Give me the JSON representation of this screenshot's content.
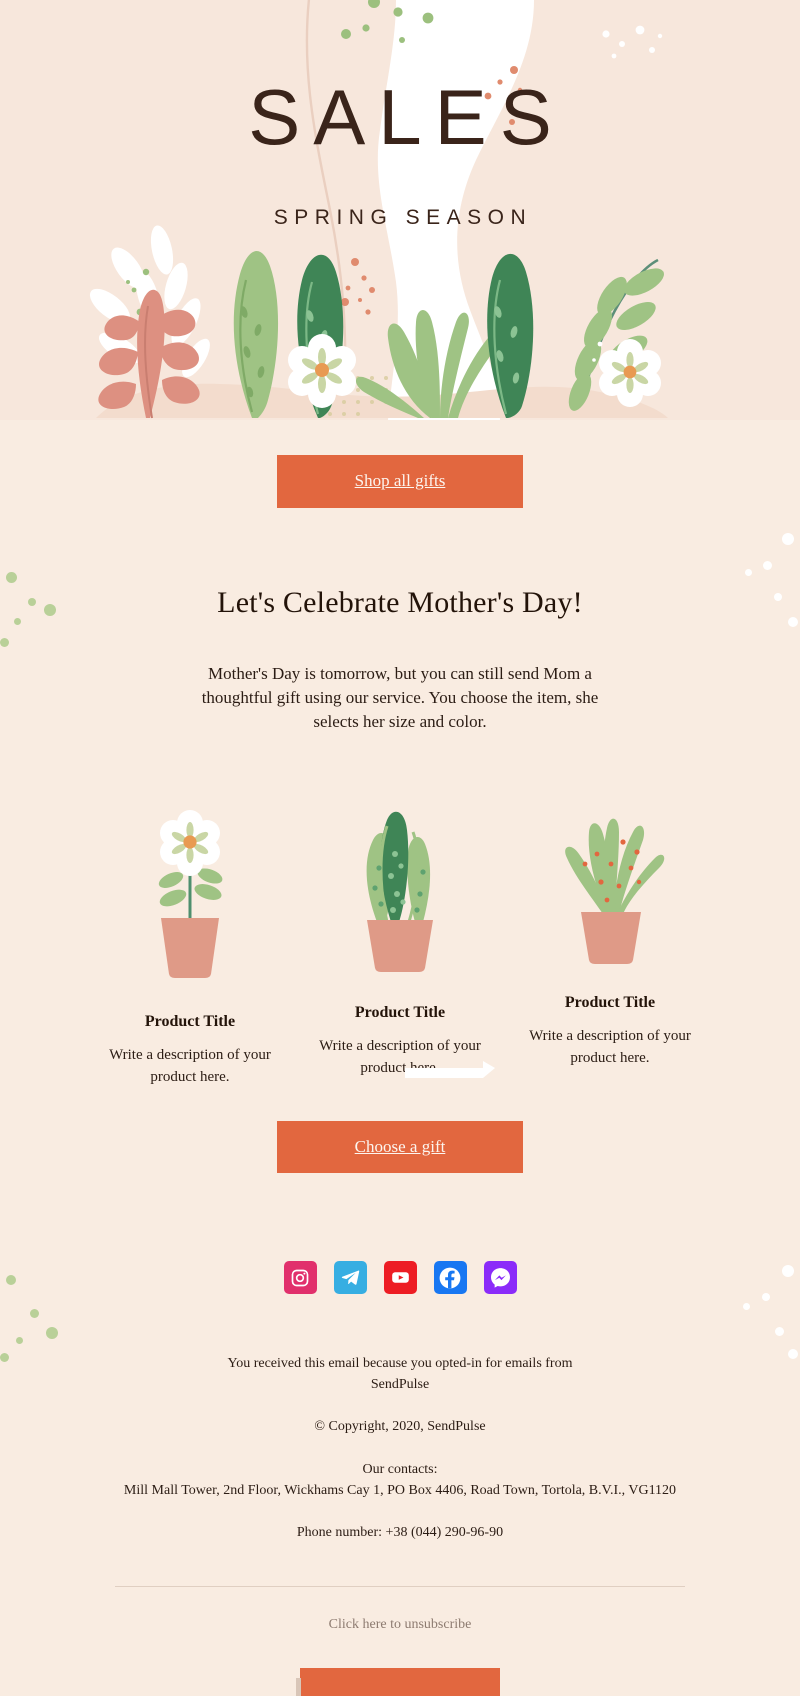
{
  "theme": {
    "page_bg": "#f9ece1",
    "hero_bg": "#f7e7dc",
    "accent": "#e2673f",
    "text": "#2b1c14",
    "heading": "#231309",
    "muted": "#8d7b70"
  },
  "hero": {
    "title": "SALES",
    "subtitle": "SPRING SEASON"
  },
  "cta_primary": {
    "label": "Shop all gifts"
  },
  "celebrate": {
    "heading": "Let's Celebrate Mother's Day!",
    "paragraph": "Mother's Day is tomorrow, but you can still send Mom a thoughtful gift using our service. You choose the item, she selects her size and color."
  },
  "products": [
    {
      "title": "Product Title",
      "description": "Write a description of your product here.",
      "art": "flower-plant-illustration"
    },
    {
      "title": "Product Title",
      "description": "Write a description of your product here.",
      "art": "snake-plant-illustration"
    },
    {
      "title": "Product Title",
      "description": "Write a description of your product here.",
      "art": "aloe-plant-illustration"
    }
  ],
  "cta_secondary": {
    "label": "Choose a gift"
  },
  "social": [
    {
      "name": "instagram",
      "label": "Instagram",
      "color": "#e1306c"
    },
    {
      "name": "telegram",
      "label": "Telegram",
      "color": "#37aee2"
    },
    {
      "name": "youtube",
      "label": "YouTube",
      "color": "#ed1d24"
    },
    {
      "name": "facebook",
      "label": "Facebook",
      "color": "#1877f2"
    },
    {
      "name": "messenger",
      "label": "Messenger",
      "color": "#8b2bf9"
    }
  ],
  "footer": {
    "optin_line1": "You received this email because you opted-in for emails from",
    "optin_line2": "SendPulse",
    "copyright": "© Copyright, 2020, SendPulse",
    "contacts_label": "Our contacts:",
    "address": "Mill Mall Tower, 2nd Floor, Wickhams Cay 1, PO Box 4406, Road Town, Tortola, B.V.I., VG1120",
    "phone": "Phone number: +38 (044) 290-96-90",
    "unsubscribe": "Click here to unsubscribe"
  }
}
